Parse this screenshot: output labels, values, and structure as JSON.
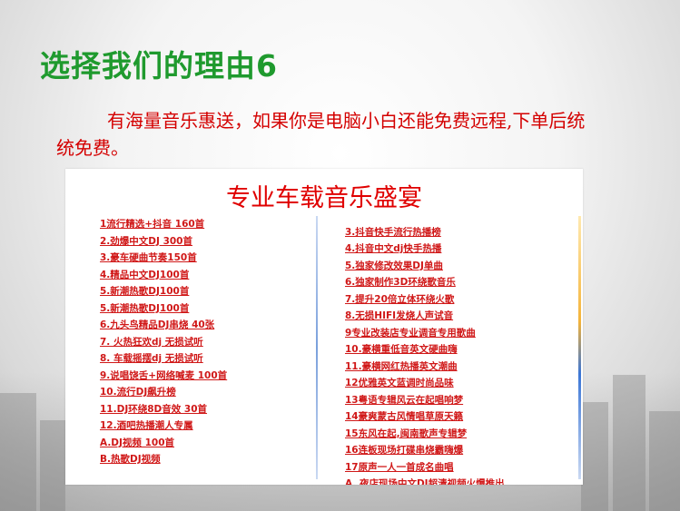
{
  "slide": {
    "title": "选择我们的理由6",
    "body": "有海量音乐惠送，如果你是电脑小白还能免费远程,下单后统统免费。"
  },
  "panel": {
    "title": "专业车载音乐盛宴",
    "left_items": [
      "1流行精选+抖音 160首",
      "2.劲爆中文DJ 300首",
      "3.豪车硬曲节奏150首",
      "4.精品中文DJ100首",
      "5.新潮热歌DJ100首",
      "5.新潮热歌DJ100首",
      "6.九头鸟精品DJ串烧 40张",
      "7. 火热狂欢dj 无损试听",
      "8. 车载摇摆dj 无损试听",
      "9.说唱饶舌+网络喊麦 100首",
      "10.流行DJ飙升榜",
      "11.DJ环绕8D音效 30首",
      "12.酒吧热播潮人专属",
      "A.DJ视频 100首",
      "B.热歌DJ视频"
    ],
    "right_items": [
      "3.抖音快手流行热播榜",
      "4.抖音中文dj快手热播",
      "5.独家修改效果DJ单曲",
      "6.独家制作3D环绕歌音乐",
      "7.提升20倍立体环绕火歌",
      "8.无损HIFI发烧人声试音",
      "9专业改装店专业调音专用歌曲",
      "10.豪横重低音英文硬曲嗨",
      "11.豪横网红热播英文潮曲",
      "12优雅英文蓝调时尚品味",
      "13粤语专辑风云在起唱响梦",
      "14豪爽蒙古风情唱草原天籁",
      "15东风在起,闽南歌声专辑梦",
      "16连板现场打碟串烧霸嗨爆",
      "17原声一人一首成名曲唱",
      "A. 夜店现场中文DJ超清视频火爆推出"
    ]
  }
}
